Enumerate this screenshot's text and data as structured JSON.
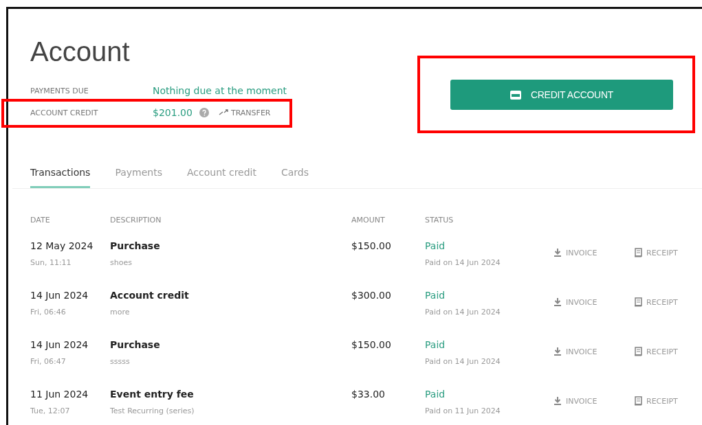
{
  "page": {
    "title": "Account"
  },
  "summary": [
    {
      "label": "PAYMENTS DUE",
      "value": "Nothing due at the moment",
      "highlighted": false
    },
    {
      "label": "ACCOUNT CREDIT",
      "value": "$201.00",
      "help": true,
      "action": "TRANSFER",
      "highlighted": true
    }
  ],
  "credit_button": {
    "label": "CREDIT ACCOUNT",
    "highlighted": true
  },
  "tabs": [
    {
      "label": "Transactions",
      "selected": true
    },
    {
      "label": "Payments",
      "selected": false
    },
    {
      "label": "Account credit",
      "selected": false
    },
    {
      "label": "Cards",
      "selected": false
    }
  ],
  "table": {
    "columns": [
      "DATE",
      "DESCRIPTION",
      "AMOUNT",
      "STATUS"
    ],
    "rows": [
      {
        "date": "12 May 2024",
        "time": "Sun, 11:11",
        "description": "Purchase",
        "note": "shoes",
        "amount": "$150.00",
        "status": "Paid",
        "status_note": "Paid on 14 Jun 2024",
        "invoice": "INVOICE",
        "receipt": "RECEIPT"
      },
      {
        "date": "14 Jun 2024",
        "time": "Fri, 06:46",
        "description": "Account credit",
        "note": "more",
        "amount": "$300.00",
        "status": "Paid",
        "status_note": "Paid on 14 Jun 2024",
        "invoice": "INVOICE",
        "receipt": "RECEIPT"
      },
      {
        "date": "14 Jun 2024",
        "time": "Fri, 06:47",
        "description": "Purchase",
        "note": "sssss",
        "amount": "$150.00",
        "status": "Paid",
        "status_note": "Paid on 14 Jun 2024",
        "invoice": "INVOICE",
        "receipt": "RECEIPT"
      },
      {
        "date": "11 Jun 2024",
        "time": "Tue, 12:07",
        "description": "Event entry fee",
        "note": "Test Recurring (series)",
        "amount": "$33.00",
        "status": "Paid",
        "status_note": "Paid on 11 Jun 2024",
        "invoice": "INVOICE",
        "receipt": "RECEIPT"
      }
    ]
  }
}
